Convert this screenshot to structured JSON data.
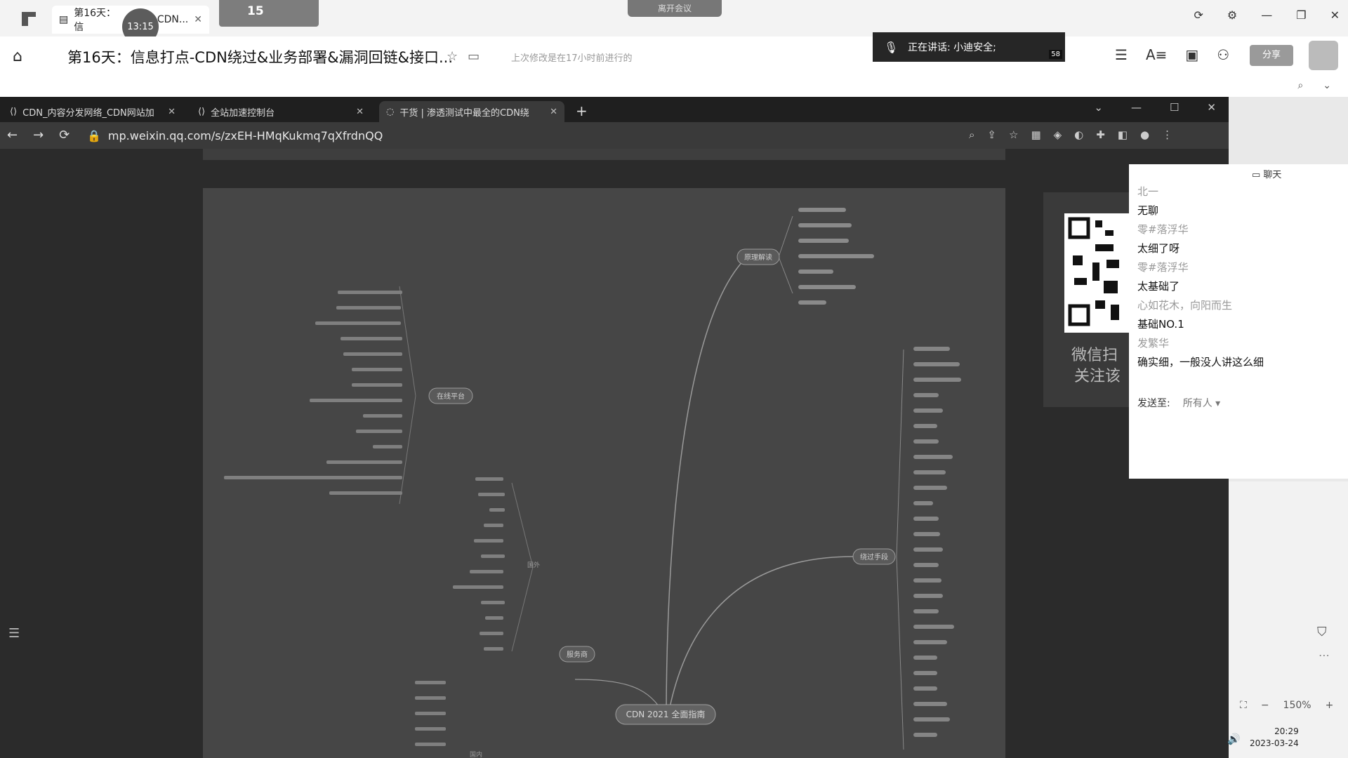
{
  "outer": {
    "doc_tab_title": "第16天：信",
    "doc_tab_tail": "CDN...",
    "time_bubble": "13:15",
    "mini_number": "15",
    "meeting_pill": "离开会议"
  },
  "doc_header": {
    "title": "第16天：信息打点-CDN绕过&业务部署&漏洞回链&接口...",
    "status": "上次修改是在17小时前进行的",
    "speaking_text": "正在讲话: 小迪安全;",
    "speaking_count": "58",
    "share_label": "分享"
  },
  "browser": {
    "tabs": [
      {
        "title": "CDN_内容分发网络_CDN网站加",
        "active": false
      },
      {
        "title": "全站加速控制台",
        "active": false
      },
      {
        "title": "干货 | 渗透测试中最全的CDN绕",
        "active": true
      }
    ],
    "url": "mp.weixin.qq.com/s/zxEH-HMqKukmq7qXfrdnQQ"
  },
  "mindmap": {
    "center": "CDN 2021 全面指南",
    "branches": {
      "top_right": "原理解读",
      "mid_right": "绕过手段",
      "left_upper": "在线平台",
      "left_lower": "服务商"
    },
    "left_small": "国外",
    "bottom_small": "国内"
  },
  "qr": {
    "line1": "微信扫",
    "line2": "关注该"
  },
  "chat": {
    "header": "聊天",
    "messages": [
      {
        "who": "北一",
        "text": "无聊"
      },
      {
        "who": "零#落浮华",
        "text": "太细了呀"
      },
      {
        "who": "零#落浮华",
        "text": "太基础了"
      },
      {
        "who": "心如花木，向阳而生",
        "text": "基础NO.1"
      },
      {
        "who": "发繁华",
        "text": "确实细，一般没人讲这么细"
      }
    ],
    "send_to_label": "发送至:",
    "send_to_value": "所有人"
  },
  "status": {
    "zoom": "150%",
    "time": "20:29",
    "date": "2023-03-24"
  }
}
